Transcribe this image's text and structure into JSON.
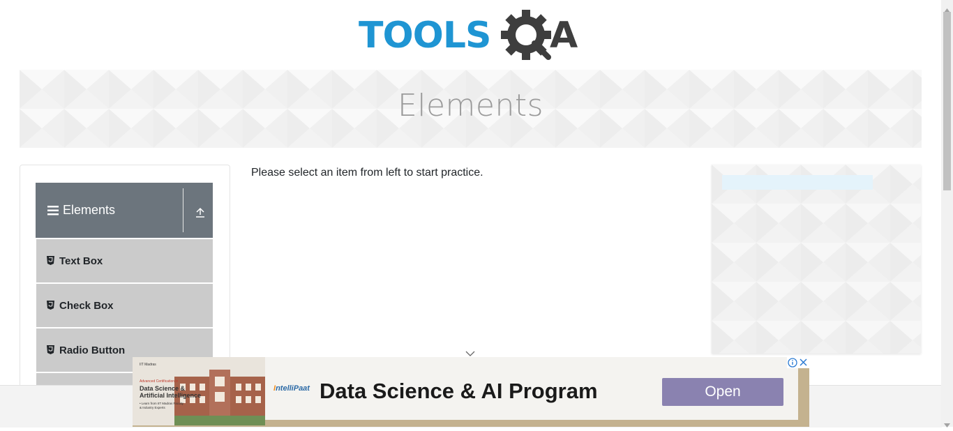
{
  "logo": {
    "text_left": "TOOLS",
    "text_right": "A",
    "color_blue": "#1f95d3",
    "color_dark": "#3e3e3e"
  },
  "banner": {
    "title": "Elements"
  },
  "sidebar": {
    "group": {
      "title": "Elements",
      "icon": "hamburger-icon",
      "toggle_icon": "collapse-up-icon"
    },
    "items": [
      {
        "label": "Text Box",
        "icon": "html5-icon"
      },
      {
        "label": "Check Box",
        "icon": "html5-icon"
      },
      {
        "label": "Radio Button",
        "icon": "html5-icon"
      }
    ]
  },
  "main": {
    "message": "Please select an item from left to start practice."
  },
  "bottom_ad": {
    "thumb_lines": [
      "IIT Madras",
      "Advanced Certification in",
      "Data Science &",
      "Artificial Intelligence",
      "• Learn from IIT Madras Faculty",
      "& Industry Experts"
    ],
    "brand_prefix": "I",
    "brand": "ntelliPaat",
    "headline": "Data Science & AI Program",
    "cta": "Open"
  },
  "colors": {
    "sidebar_header": "#6c757d",
    "menu_item": "#cbcbcb",
    "cta": "#8a82b0"
  }
}
